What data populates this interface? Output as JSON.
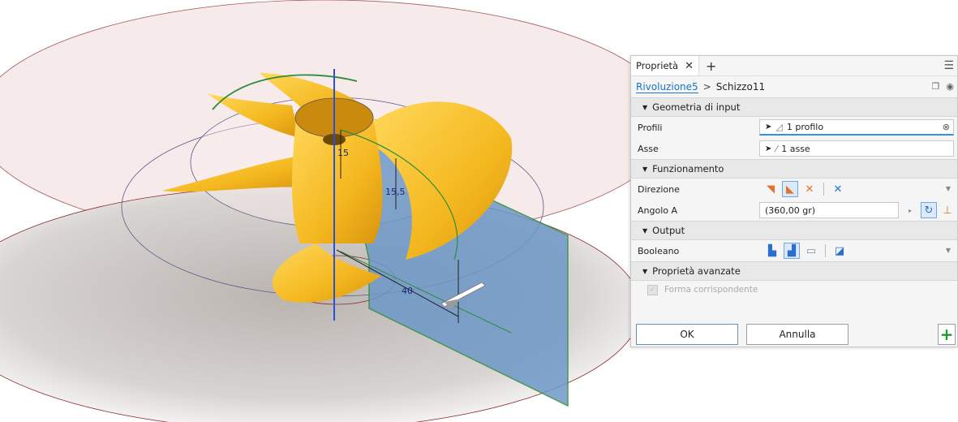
{
  "viewport": {
    "dimensions": [
      {
        "id": "dim-15",
        "text": "15"
      },
      {
        "id": "dim-15-5",
        "text": "15,5"
      },
      {
        "id": "dim-40",
        "text": "40"
      }
    ],
    "colors": {
      "propeller": "#f5c12e",
      "plane": "#6e98c8",
      "axis": "#2b4fd8",
      "sketch": "#2e8c3a",
      "circle": "#8b2b2b"
    }
  },
  "panel": {
    "tab_label": "Proprietà",
    "tab_close": "✕",
    "tab_add": "+",
    "menu_icon": "☰",
    "breadcrumb": {
      "feature": "Rivoluzione5",
      "separator": ">",
      "sketch": "Schizzo11"
    },
    "sections": {
      "input": "Geometria di input",
      "behavior": "Funzionamento",
      "output": "Output",
      "advanced": "Proprietà avanzate"
    },
    "rows": {
      "profiles": {
        "label": "Profili",
        "value": "1 profilo"
      },
      "axis": {
        "label": "Asse",
        "value": "1 asse"
      },
      "direction": {
        "label": "Direzione"
      },
      "angle": {
        "label": "Angolo A",
        "value": "(360,00 gr)"
      },
      "boolean": {
        "label": "Booleano"
      }
    },
    "match_shape": "Forma corrispondente",
    "ok": "OK",
    "cancel": "Annulla",
    "add": "+"
  }
}
